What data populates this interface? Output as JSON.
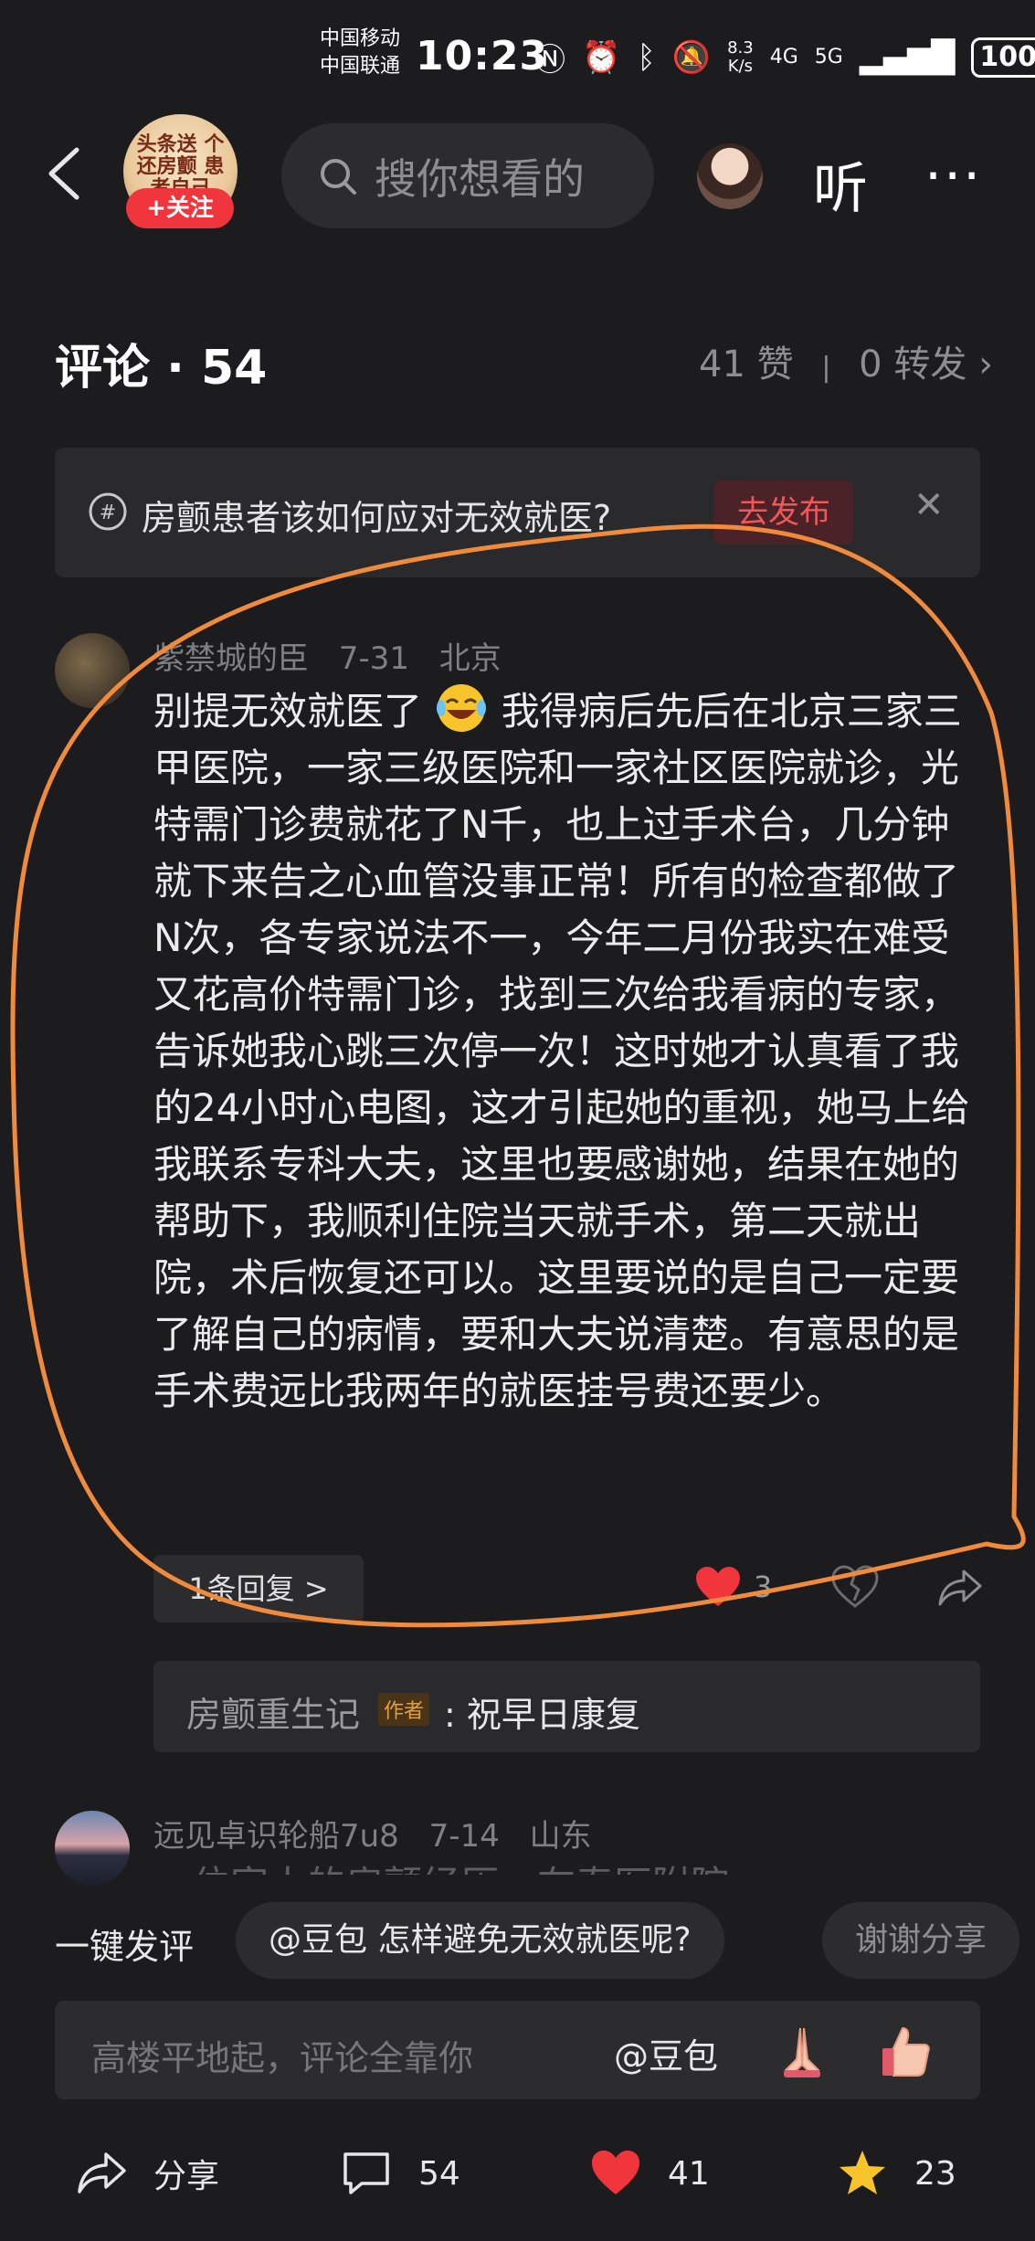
{
  "status_bar": {
    "carrier1": "中国移动",
    "carrier2": "中国联通",
    "time": "10:23",
    "net_speed_value": "8.3",
    "net_speed_unit": "K/s",
    "signal1": "4G",
    "signal2": "5G",
    "battery": "100"
  },
  "header": {
    "account_logo_text": "头条送 个还房颤 患者自己",
    "follow_label": "+关注",
    "search_placeholder": "搜你想看的",
    "listen_label": "听",
    "more_label": "···"
  },
  "comments_header": {
    "title": "评论 · 54",
    "likes": "41 赞",
    "divider": "|",
    "shares": "0 转发"
  },
  "topic": {
    "text": "房颤患者该如何应对无效就医?",
    "publish_label": "去发布"
  },
  "comment1": {
    "username": "紫禁城的臣",
    "date": "7-31",
    "location": "北京",
    "text_before_emoji": "别提无效就医了",
    "text_after_emoji": "我得病后先后在北京三家三甲医院，一家三级医院和一家社区医院就诊，光特需门诊费就花了N千，也上过手术台，几分钟就下来告之心血管没事正常！所有的检查都做了N次，各专家说法不一，今年二月份我实在难受又花高价特需门诊，找到三次给我看病的专家，告诉她我心跳三次停一次！这时她才认真看了我的24小时心电图，这才引起她的重视，她马上给我联系专科大夫，这里也要感谢她，结果在她的帮助下，我顺利住院当天就手术，第二天就出院，术后恢复还可以。这里要说的是自己一定要了解自己的病情，要和大夫说清楚。有意思的是手术费远比我两年的就医挂号费还要少。",
    "reply_count_label": "1条回复 >",
    "like_count": "3"
  },
  "reply": {
    "author": "房颤重生记",
    "badge": "作者",
    "text": ": 祝早日康复"
  },
  "comment2": {
    "username": "远见卓识轮船7u8",
    "date": "7-14",
    "location": "山东",
    "peek_text": "一位家人的房颤经历，在春医附院..."
  },
  "quick_comment": {
    "label": "一键发评",
    "chips": [
      "@豆包 怎样避免无效就医呢?",
      "谢谢分享"
    ]
  },
  "input": {
    "placeholder": "高楼平地起，评论全靠你",
    "doubao_label": "@豆包"
  },
  "bottom_bar": {
    "share_label": "分享",
    "comment_count": "54",
    "like_count": "41",
    "favorite_count": "23"
  },
  "colors": {
    "background": "#1c1c1e",
    "accent_red": "#f0353d",
    "marker_orange": "#f08a3c",
    "star_yellow": "#f7c42b"
  }
}
